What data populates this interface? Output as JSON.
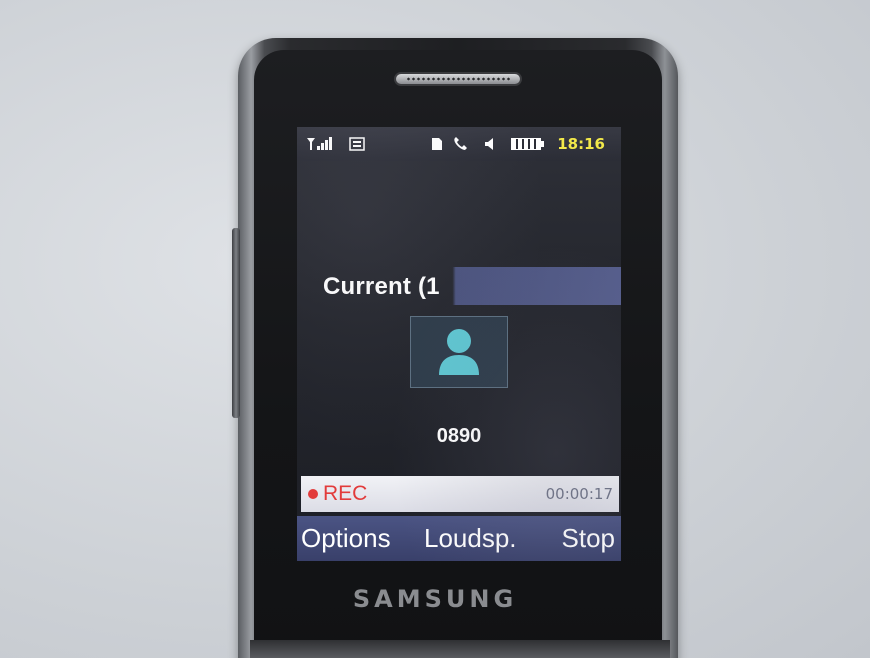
{
  "status_bar": {
    "icons": [
      "signal-icon",
      "message-icon",
      "sim-icon",
      "call-icon",
      "speaker-icon",
      "battery-icon"
    ],
    "time": "18:16"
  },
  "call": {
    "title": "Current (1",
    "caller_number": "0890",
    "avatar_icon": "person-icon"
  },
  "recording": {
    "label": "REC",
    "timer": "00:00:17",
    "color": "#e23b3b"
  },
  "softkeys": {
    "left": "Options",
    "center": "Loudsp.",
    "right": "Stop"
  },
  "device": {
    "brand": "SAMSUNG"
  },
  "colors": {
    "clock": "#f2e84a",
    "softkey_bar": "#4b5484",
    "rec_bar": "#e8e9ef"
  }
}
